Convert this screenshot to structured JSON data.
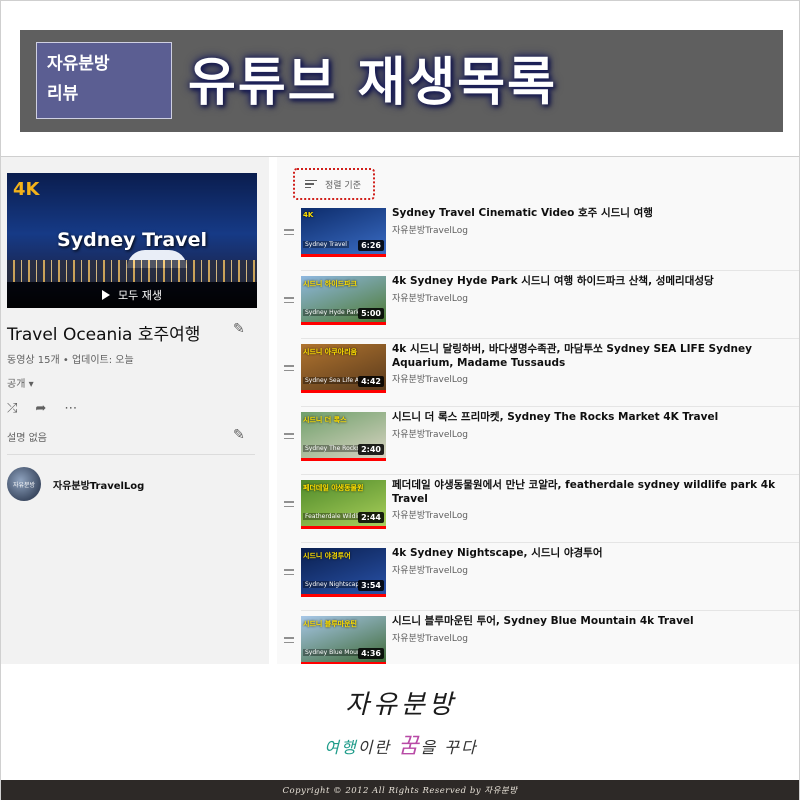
{
  "banner": {
    "badge_line1": "자유분방",
    "badge_line2": "리뷰",
    "title": "유튜브 재생목록"
  },
  "playlist": {
    "hero_quality": "4K",
    "hero_title": "Sydney Travel",
    "play_all_label": "모두 재생",
    "title": "Travel Oceania 호주여행",
    "meta": "동영상 15개 • 업데이트: 오늘",
    "privacy": "공개",
    "description": "설명 없음",
    "owner": "자유분방TravelLog",
    "owner_avatar_text": "자유분방"
  },
  "sort": {
    "label": "정렬 기준"
  },
  "videos": [
    {
      "title": "Sydney Travel Cinematic Video 호주 시드니 여행",
      "channel": "자유분방TravelLog",
      "duration": "6:26",
      "tag": "4K",
      "label": "Sydney Travel",
      "c1": "#0d2c6b",
      "c2": "#3a6cc4"
    },
    {
      "title": "4k Sydney Hyde Park 시드니 여행 하이드파크 산책, 성메리대성당",
      "channel": "자유분방TravelLog",
      "duration": "5:00",
      "tag": "시드니 하이드파크",
      "label": "Sydney Hyde Park",
      "c1": "#8fb8e0",
      "c2": "#4d7a32"
    },
    {
      "title": "4k 시드니 달링하버, 바다생명수족관, 마담투쏘 Sydney SEA LIFE Sydney Aquarium, Madame Tussauds",
      "channel": "자유분방TravelLog",
      "duration": "4:42",
      "tag": "시드니 아쿠아리움",
      "label": "Sydney Sea Life Aqua",
      "c1": "#b0742f",
      "c2": "#5a3a1c"
    },
    {
      "title": "시드니 더 록스 프리마켓, Sydney The Rocks Market 4K Travel",
      "channel": "자유분방TravelLog",
      "duration": "2:40",
      "tag": "시드니 더 록스",
      "label": "Sydney The Rocks Market",
      "c1": "#6fa06a",
      "c2": "#d8d3c2"
    },
    {
      "title": "페더데일 야생동물원에서 만난 코알라, featherdale sydney wildlife park 4k Travel",
      "channel": "자유분방TravelLog",
      "duration": "2:44",
      "tag": "페더데일 야생동물원",
      "label": "Featherdale Wildlife Park",
      "c1": "#4f8a2a",
      "c2": "#a9cf5a"
    },
    {
      "title": "4k Sydney Nightscape, 시드니 야경투어",
      "channel": "자유분방TravelLog",
      "duration": "3:54",
      "tag": "시드니 야경투어",
      "label": "Sydney Nightscape",
      "c1": "#0a1f4f",
      "c2": "#2952a8"
    },
    {
      "title": "시드니 블루마운틴 투어, Sydney Blue Mountain 4k Travel",
      "channel": "자유분방TravelLog",
      "duration": "4:36",
      "tag": "시드니 블루마운틴",
      "label": "Sydney Blue Mountain",
      "c1": "#a7c7e8",
      "c2": "#3f6a37"
    }
  ],
  "brand": {
    "name": "자유분방",
    "slogan_1": "여행",
    "slogan_2": "이란 ",
    "slogan_3": "꿈",
    "slogan_4": "을 꾸다",
    "copyright": "Copyright © 2012 All Rights Reserved by 자유분방"
  }
}
